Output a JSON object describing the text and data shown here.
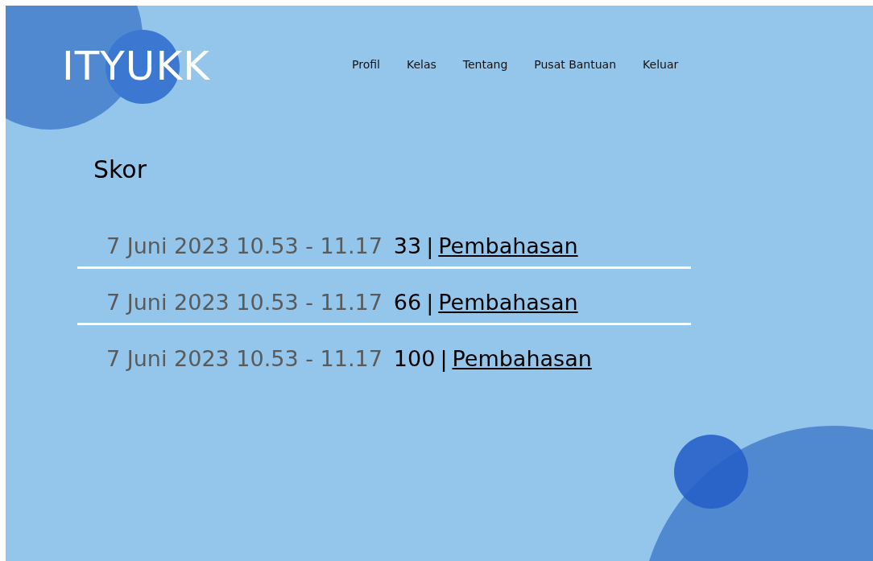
{
  "header": {
    "logo": "ITYUKK",
    "nav": [
      {
        "label": "Profil"
      },
      {
        "label": "Kelas"
      },
      {
        "label": "Tentang"
      },
      {
        "label": "Pusat Bantuan"
      },
      {
        "label": "Keluar"
      }
    ]
  },
  "title": "Skor",
  "scores": [
    {
      "time": "7 Juni 2023 10.53 - 11.17",
      "score": "33",
      "separator": "|",
      "link": "Pembahasan"
    },
    {
      "time": "7 Juni 2023 10.53 - 11.17",
      "score": "66",
      "separator": "|",
      "link": "Pembahasan"
    },
    {
      "time": "7 Juni 2023 10.53 - 11.17",
      "score": "100",
      "separator": "|",
      "link": "Pembahasan"
    }
  ]
}
